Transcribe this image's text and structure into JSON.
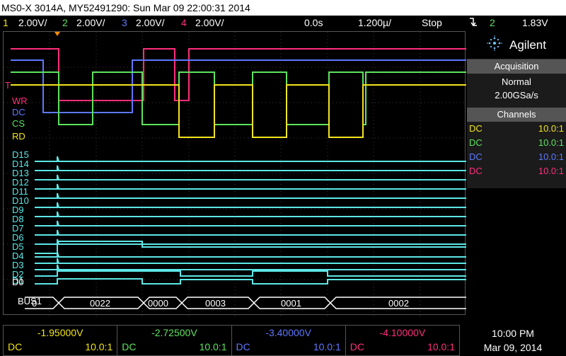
{
  "colors": {
    "ch1": "#f2e41e",
    "ch2": "#5ee35e",
    "ch3": "#5d78ff",
    "ch4": "#ff2e7c",
    "digital": "#5de7e7",
    "panel": "#555555"
  },
  "title": "MS0-X 3014A, MY52491290: Sun Mar 09 22:00:31 2014",
  "status": {
    "ch1_num": "1",
    "ch1_scale": "2.00V/",
    "ch2_num": "2",
    "ch2_scale": "2.00V/",
    "ch3_num": "3",
    "ch3_scale": "2.00V/",
    "ch4_num": "4",
    "ch4_scale": "2.00V/",
    "delay": "0.0s",
    "timebase": "1.200µ/",
    "run_state": "Stop",
    "trigger_icon": "trigger-edge-falling-icon",
    "trigger_channel": "2",
    "trigger_level": "1.83V"
  },
  "brand": {
    "name": "Agilent",
    "icon": "agilent-spark-icon"
  },
  "acquisition": {
    "header": "Acquisition",
    "mode": "Normal",
    "rate": "2.00GSa/s"
  },
  "channels": {
    "header": "Channels",
    "rows": [
      {
        "coupling": "DC",
        "probe": "10.0:1"
      },
      {
        "coupling": "DC",
        "probe": "10.0:1"
      },
      {
        "coupling": "DC",
        "probe": "10.0:1"
      },
      {
        "coupling": "DC",
        "probe": "10.0:1"
      }
    ]
  },
  "trace_labels": {
    "wr": "WR",
    "dc": "DC",
    "cs": "CS",
    "rd": "RD",
    "t": "T"
  },
  "digital_labels": [
    "D15",
    "D14",
    "D13",
    "D12",
    "D11",
    "D10",
    "D9",
    "D8",
    "D7",
    "D6",
    "D5",
    "D4",
    "D3",
    "D2",
    "D1",
    "D0"
  ],
  "bus": {
    "label": "BUS1",
    "values": [
      "0",
      "0022",
      "0000",
      "0003",
      "0001",
      "0002"
    ]
  },
  "offsets": [
    {
      "value": "-1.95000V",
      "coupling": "DC",
      "probe": "10.0:1"
    },
    {
      "value": "-2.72500V",
      "coupling": "DC",
      "probe": "10.0:1"
    },
    {
      "value": "-3.40000V",
      "coupling": "DC",
      "probe": "10.0:1"
    },
    {
      "value": "-4.10000V",
      "coupling": "DC",
      "probe": "10.0:1"
    }
  ],
  "clock": {
    "time": "10:00 PM",
    "date": "Mar 09, 2014"
  }
}
